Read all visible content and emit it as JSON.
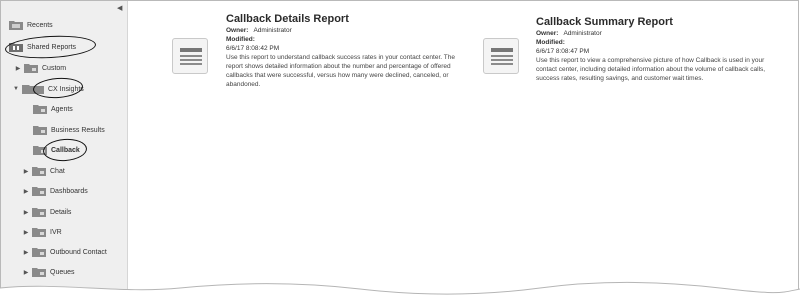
{
  "sidebar": {
    "collapse_icon": "triangle-left-icon",
    "items": [
      {
        "label": "Recents",
        "icon": "recents-folder-icon"
      },
      {
        "label": "Shared Reports",
        "icon": "shared-folder-icon"
      },
      {
        "label": "Custom",
        "icon": "folder-icon"
      },
      {
        "label": "CX Insights",
        "icon": "folder-open-icon"
      },
      {
        "label": "Agents",
        "icon": "folder-icon"
      },
      {
        "label": "Business Results",
        "icon": "folder-icon"
      },
      {
        "label": "Callback",
        "icon": "folder-icon"
      },
      {
        "label": "Chat",
        "icon": "folder-icon"
      },
      {
        "label": "Dashboards",
        "icon": "folder-icon"
      },
      {
        "label": "Details",
        "icon": "folder-icon"
      },
      {
        "label": "IVR",
        "icon": "folder-icon"
      },
      {
        "label": "Outbound Contact",
        "icon": "folder-icon"
      },
      {
        "label": "Queues",
        "icon": "folder-icon"
      }
    ]
  },
  "reports": [
    {
      "title": "Callback Details Report",
      "owner_label": "Owner:",
      "owner": "Administrator",
      "modified_label": "Modified:",
      "modified": "6/6/17 8:08:42 PM",
      "description": "Use this report to understand callback success rates in your contact center. The report shows detailed information about the number and percentage of offered callbacks that were successful, versus how many were declined, canceled, or abandoned."
    },
    {
      "title": "Callback Summary Report",
      "owner_label": "Owner:",
      "owner": "Administrator",
      "modified_label": "Modified:",
      "modified": "6/6/17 8:08:47 PM",
      "description": "Use this report to view a comprehensive picture of how Callback is used in your contact center, including detailed information about the volume of callback calls, success rates, resulting savings, and customer wait times."
    }
  ],
  "colors": {
    "sidebar_bg": "#efefef",
    "folder": "#8a8a8a",
    "annotation_oval": "#111111"
  }
}
